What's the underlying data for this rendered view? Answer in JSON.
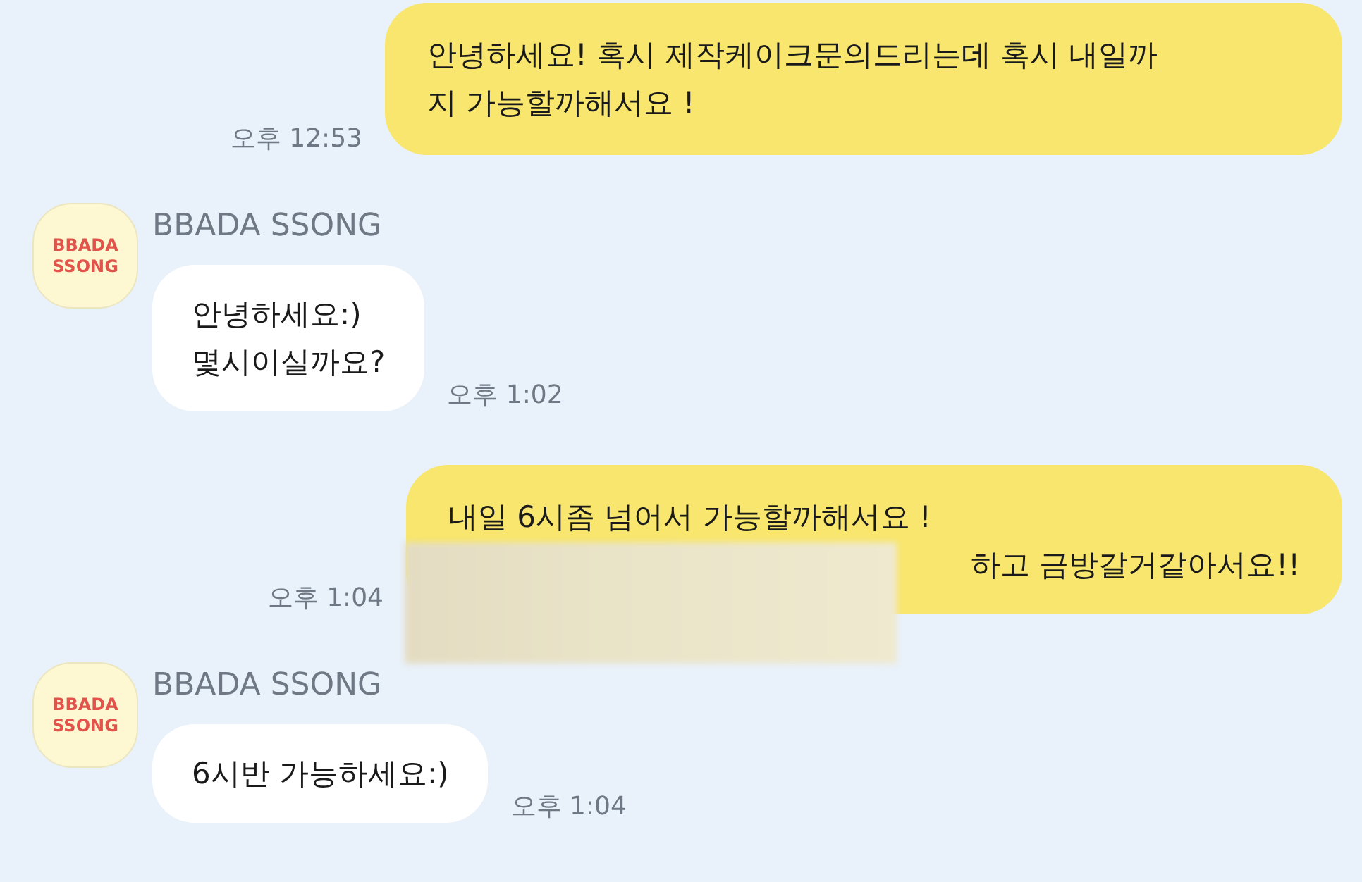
{
  "messages": [
    {
      "kind": "outgoing",
      "lines": [
        "안녕하세요! 혹시 제작케이크문의드리는데 혹시 내일까",
        "지 가능할까해서요 !"
      ],
      "time": "오후 12:53"
    },
    {
      "kind": "incoming",
      "sender": "BBADA SSONG",
      "avatar_text": [
        "BBADA",
        "SSONG"
      ],
      "lines": [
        "안녕하세요:)",
        "몇시이실까요?"
      ],
      "time": "오후 1:02"
    },
    {
      "kind": "outgoing",
      "lines": [
        "내일 6시좀 넘어서 가능할까해서요 !",
        "하고 금방갈거같아서요!!"
      ],
      "time": "오후 1:04",
      "redacted": true
    },
    {
      "kind": "incoming",
      "sender": "BBADA SSONG",
      "avatar_text": [
        "BBADA",
        "SSONG"
      ],
      "lines": [
        "6시반 가능하세요:)"
      ],
      "time": "오후 1:04"
    }
  ]
}
